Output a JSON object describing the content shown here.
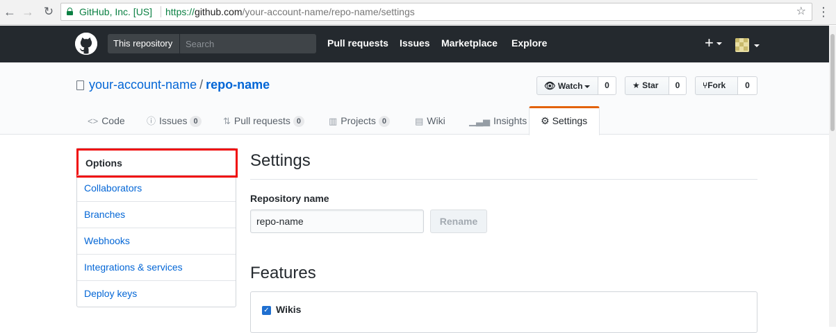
{
  "browser": {
    "back_icon": "←",
    "forward_icon": "→",
    "reload_icon": "↻",
    "site_identity": "GitHub, Inc. [US]",
    "url_protocol": "https://",
    "url_host": "github.com",
    "url_path": "/your-account-name/repo-name/settings",
    "bookmark_icon": "☆",
    "menu_icon": "⋮"
  },
  "gh_header": {
    "scope_label": "This repository",
    "search_placeholder": "Search",
    "nav": [
      "Pull requests",
      "Issues",
      "Marketplace",
      "Explore"
    ],
    "plus_icon": "+"
  },
  "repo": {
    "owner": "your-account-name",
    "separator": "/",
    "name": "repo-name",
    "actions": {
      "watch": {
        "label": "Watch",
        "count": "0"
      },
      "star": {
        "label": "Star",
        "count": "0"
      },
      "fork": {
        "label": "Fork",
        "count": "0"
      }
    },
    "tabs": {
      "code": {
        "label": "Code"
      },
      "issues": {
        "label": "Issues",
        "count": "0"
      },
      "pulls": {
        "label": "Pull requests",
        "count": "0"
      },
      "projects": {
        "label": "Projects",
        "count": "0"
      },
      "wiki": {
        "label": "Wiki"
      },
      "insights": {
        "label": "Insights"
      },
      "settings": {
        "label": "Settings"
      }
    }
  },
  "sidebar": {
    "items": [
      "Options",
      "Collaborators",
      "Branches",
      "Webhooks",
      "Integrations & services",
      "Deploy keys"
    ],
    "selected": "Options"
  },
  "main": {
    "title": "Settings",
    "repo_name_label": "Repository name",
    "repo_name_value": "repo-name",
    "rename_label": "Rename",
    "features_title": "Features",
    "wikis_label": "Wikis",
    "wikis_checked": true
  },
  "colors": {
    "header_bg": "#24292e",
    "link": "#0366d6",
    "selected_tab_accent": "#e36209",
    "highlight_box": "#f00a0a"
  }
}
